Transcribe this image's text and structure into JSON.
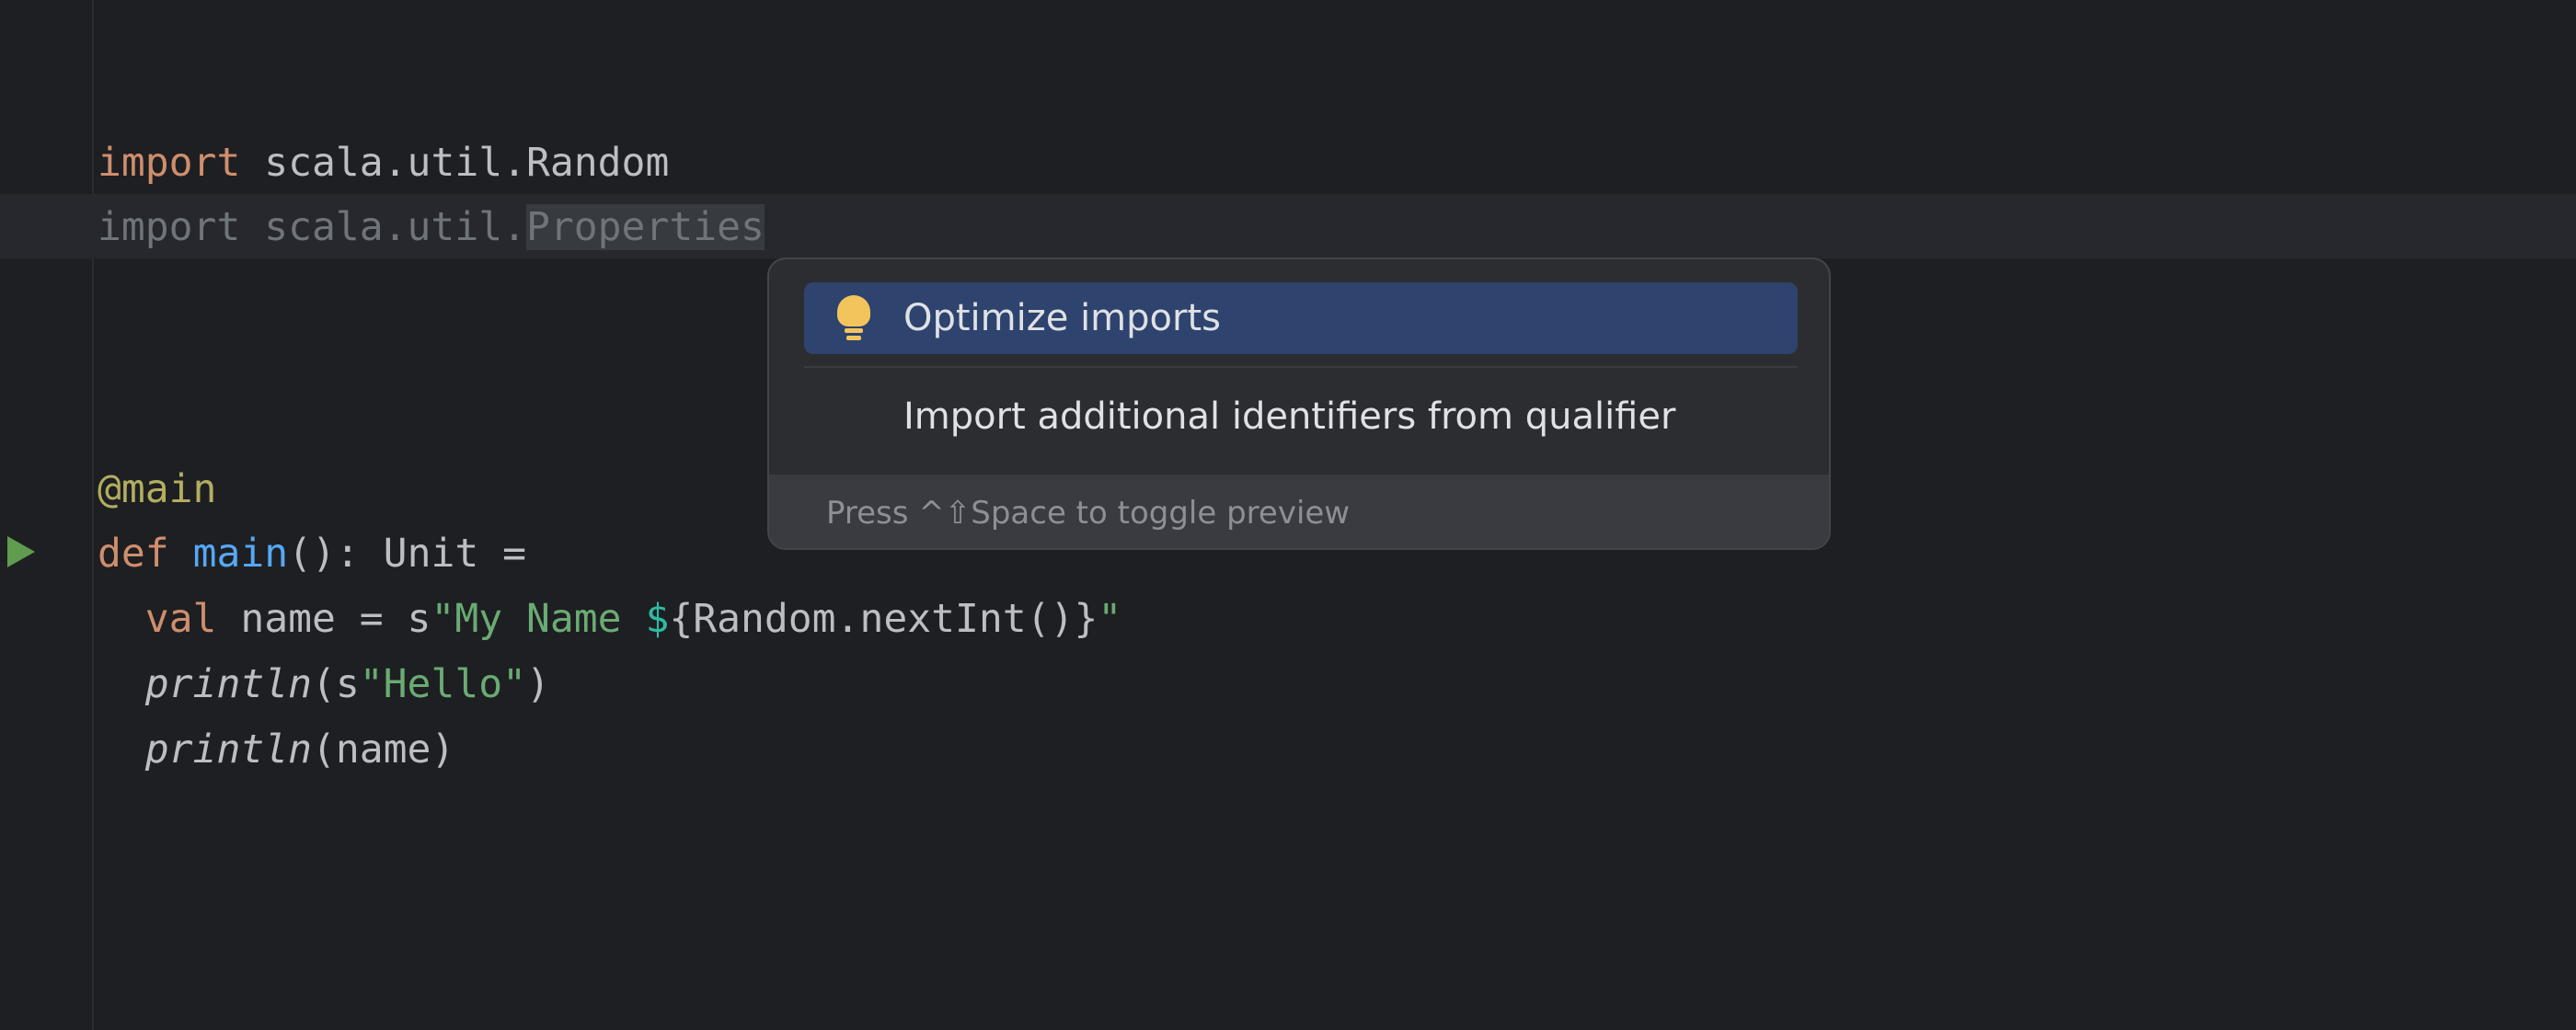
{
  "editor": {
    "lines": [
      {
        "tokens": [
          {
            "text": "import",
            "cls": "kw"
          },
          {
            "text": " scala.util.Random",
            "cls": ""
          }
        ]
      },
      {
        "tokens": [
          {
            "text": "import scala.util.",
            "cls": "unused"
          },
          {
            "text": "Properties",
            "cls": "sel-word"
          }
        ]
      },
      {
        "tokens": [
          {
            "text": "@main",
            "cls": "ann"
          }
        ]
      },
      {
        "tokens": [
          {
            "text": "def",
            "cls": "kw"
          },
          {
            "text": " ",
            "cls": ""
          },
          {
            "text": "main",
            "cls": "fn"
          },
          {
            "text": "(): Unit =",
            "cls": ""
          }
        ]
      },
      {
        "tokens": [
          {
            "text": "  ",
            "cls": ""
          },
          {
            "text": "val",
            "cls": "kw"
          },
          {
            "text": " name = s",
            "cls": ""
          },
          {
            "text": "\"My Name ",
            "cls": "str"
          },
          {
            "text": "$",
            "cls": "interp"
          },
          {
            "text": "{Random.nextInt()}",
            "cls": ""
          },
          {
            "text": "\"",
            "cls": "str"
          }
        ]
      },
      {
        "tokens": [
          {
            "text": "  ",
            "cls": ""
          },
          {
            "text": "println",
            "cls": "ital"
          },
          {
            "text": "(s",
            "cls": ""
          },
          {
            "text": "\"Hello\"",
            "cls": "str"
          },
          {
            "text": ")",
            "cls": ""
          }
        ]
      },
      {
        "tokens": [
          {
            "text": "  ",
            "cls": ""
          },
          {
            "text": "println",
            "cls": "ital"
          },
          {
            "text": "(name)",
            "cls": ""
          }
        ]
      }
    ]
  },
  "gutter": {
    "run_icon": "run-triangle-icon"
  },
  "popup": {
    "items": [
      {
        "label": "Optimize imports",
        "icon": "lightbulb-icon"
      },
      {
        "label": "Import additional identifiers from qualifier"
      }
    ],
    "hint": "Press ^⇧Space to toggle preview"
  }
}
